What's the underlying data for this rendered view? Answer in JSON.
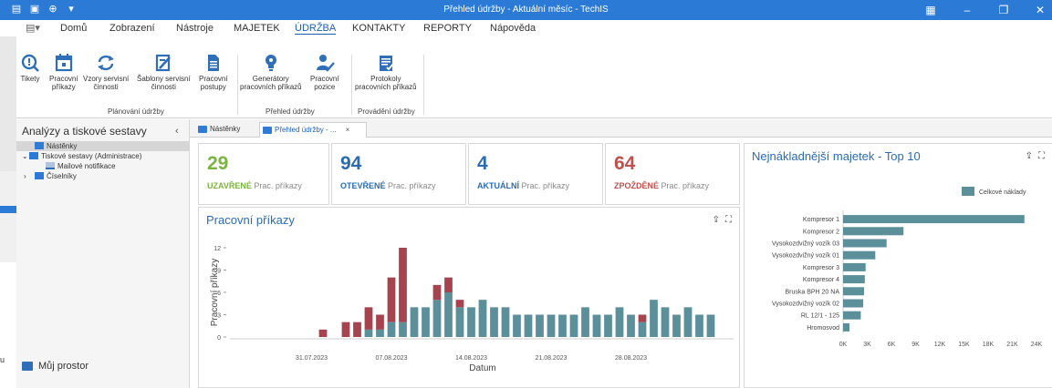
{
  "window": {
    "title": "Přehled údržby - Aktuální měsíc - TechIS",
    "accent": "#2b7bd6"
  },
  "menu": {
    "items": [
      "Domů",
      "Zobrazení",
      "Nástroje",
      "MAJETEK",
      "ÚDRŽBA",
      "KONTAKTY",
      "REPORTY",
      "Nápověda"
    ],
    "active": "ÚDRŽBA"
  },
  "ribbon": {
    "buttons": {
      "tikety": "Tikety",
      "pracovni_prikazy_1": "Pracovní",
      "pracovni_prikazy_2": "příkazy",
      "vzory_1": "Vzory servisní",
      "vzory_2": "činnosti",
      "sablony_1": "Šablony servisní",
      "sablony_2": "činnosti",
      "postupy_1": "Pracovní",
      "postupy_2": "postupy",
      "generatory_1": "Generátory",
      "generatory_2": "pracovních příkazů",
      "pozice_1": "Pracovní",
      "pozice_2": "pozice",
      "protokoly_1": "Protokoly",
      "protokoly_2": "pracovních příkazů"
    },
    "groups": {
      "planovani": "Plánování údržby",
      "prehled": "Přehled údržby",
      "provadeni": "Provádění údržby"
    }
  },
  "left_panel": {
    "title": "Analýzy a tiskové sestavy",
    "tree": {
      "nastenky": "Nástěnky",
      "tiskove": "Tiskové sestavy (Administrace)",
      "mailove": "Mailové notifikace",
      "ciselniky": "Číselníky"
    },
    "bottom": "Můj prostor",
    "ghost_text": "u"
  },
  "tabs": {
    "nastenky": "Nástěnky",
    "prehled": "Přehled údržby - ..."
  },
  "kpis": {
    "uzavrene": {
      "value": "29",
      "label": "UZAVŘENÉ",
      "sub": "Prac. příkazy",
      "color": "#7cb342"
    },
    "otevrene": {
      "value": "94",
      "label": "OTEVŘENÉ",
      "sub": "Prac. příkazy",
      "color": "#2b6cb0"
    },
    "aktualni": {
      "value": "4",
      "label": "AKTUÁLNÍ",
      "sub": "Prac. příkazy",
      "color": "#2b6cb0"
    },
    "zpozdene": {
      "value": "64",
      "label": "ZPOŽDĚNÉ",
      "sub": "Prac. příkazy",
      "color": "#c0504d"
    }
  },
  "chart_data": [
    {
      "type": "bar",
      "stacked": true,
      "title": "Pracovní příkazy",
      "xlabel": "Datum",
      "ylabel": "Pracovní příkazy",
      "ylim": [
        0,
        12
      ],
      "yticks": [
        0,
        3,
        6,
        9,
        12
      ],
      "grid": false,
      "x_tick_labels": [
        "31.07.2023",
        "07.08.2023",
        "14.08.2023",
        "21.08.2023",
        "28.08.2023"
      ],
      "x_tick_days": [
        7,
        14,
        21,
        28,
        35
      ],
      "colors": {
        "bottom": "#5b8f99",
        "top": "#a5434f"
      },
      "bars": [
        {
          "day": 8,
          "bottom": 0,
          "top": 1
        },
        {
          "day": 10,
          "bottom": 0,
          "top": 2
        },
        {
          "day": 11,
          "bottom": 0,
          "top": 2
        },
        {
          "day": 12,
          "bottom": 1,
          "top": 3
        },
        {
          "day": 13,
          "bottom": 1,
          "top": 2
        },
        {
          "day": 14,
          "bottom": 2,
          "top": 6
        },
        {
          "day": 15,
          "bottom": 2,
          "top": 10
        },
        {
          "day": 16,
          "bottom": 4,
          "top": 0
        },
        {
          "day": 17,
          "bottom": 4,
          "top": 0
        },
        {
          "day": 18,
          "bottom": 5,
          "top": 2
        },
        {
          "day": 19,
          "bottom": 6,
          "top": 2
        },
        {
          "day": 20,
          "bottom": 4,
          "top": 1
        },
        {
          "day": 21,
          "bottom": 4,
          "top": 0
        },
        {
          "day": 22,
          "bottom": 5,
          "top": 0
        },
        {
          "day": 23,
          "bottom": 4,
          "top": 0
        },
        {
          "day": 24,
          "bottom": 4,
          "top": 0
        },
        {
          "day": 25,
          "bottom": 3,
          "top": 0
        },
        {
          "day": 26,
          "bottom": 3,
          "top": 0
        },
        {
          "day": 27,
          "bottom": 3,
          "top": 0
        },
        {
          "day": 28,
          "bottom": 3,
          "top": 0
        },
        {
          "day": 29,
          "bottom": 3,
          "top": 0
        },
        {
          "day": 30,
          "bottom": 3,
          "top": 0
        },
        {
          "day": 31,
          "bottom": 4,
          "top": 0
        },
        {
          "day": 32,
          "bottom": 3,
          "top": 0
        },
        {
          "day": 33,
          "bottom": 3,
          "top": 0
        },
        {
          "day": 34,
          "bottom": 4,
          "top": 0
        },
        {
          "day": 35,
          "bottom": 3,
          "top": 0
        },
        {
          "day": 36,
          "bottom": 2,
          "top": 1
        },
        {
          "day": 37,
          "bottom": 5,
          "top": 0
        },
        {
          "day": 38,
          "bottom": 4,
          "top": 0
        },
        {
          "day": 39,
          "bottom": 3,
          "top": 0
        },
        {
          "day": 40,
          "bottom": 4,
          "top": 0
        },
        {
          "day": 41,
          "bottom": 3,
          "top": 0
        },
        {
          "day": 42,
          "bottom": 3,
          "top": 0
        }
      ]
    },
    {
      "type": "bar",
      "orientation": "horizontal",
      "title": "Nejnákladnější majetek - Top 10",
      "legend": "Celkové náklady",
      "legend_position": "top-right",
      "color": "#5b8f99",
      "xlim": [
        0,
        24000
      ],
      "xticks": [
        "0K",
        "3K",
        "6K",
        "9K",
        "12K",
        "15K",
        "18K",
        "21K",
        "24K"
      ],
      "categories": [
        "Kompresor 1",
        "Kompresor 2",
        "Vysokozdvižný vozík 03",
        "Vysokozdvižný vozík 01",
        "Kompresor 3",
        "Kompresor 4",
        "Bruska BPH 20 NA",
        "Vysokozdvižný vozík 02",
        "RL 12/1 - 125",
        "Hromosvod"
      ],
      "values": [
        22500,
        7500,
        5400,
        4000,
        2800,
        2700,
        2600,
        2500,
        2200,
        800
      ]
    }
  ]
}
